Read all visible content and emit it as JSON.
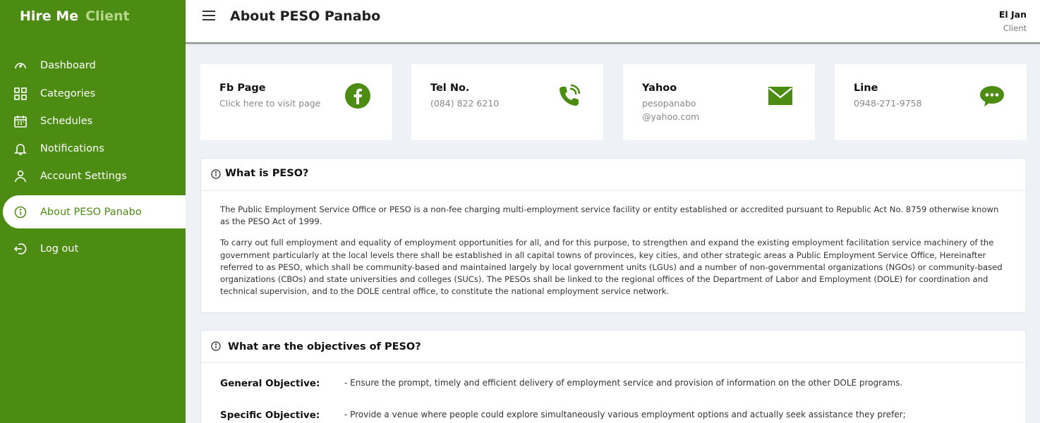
{
  "sidebar": {
    "brand_primary": "Hire Me",
    "brand_secondary": "Client",
    "items": [
      {
        "label": "Dashboard",
        "icon": "gauge-icon"
      },
      {
        "label": "Categories",
        "icon": "grid-icon"
      },
      {
        "label": "Schedules",
        "icon": "calendar-icon"
      },
      {
        "label": "Notifications",
        "icon": "bell-icon"
      },
      {
        "label": "Account Settings",
        "icon": "user-icon"
      },
      {
        "label": "About PESO Panabo",
        "icon": "info-icon",
        "active": true
      },
      {
        "label": "Log out",
        "icon": "logout-icon"
      }
    ]
  },
  "header": {
    "title": "About PESO Panabo",
    "user_name": "El Jan",
    "user_role": "Client"
  },
  "contacts": [
    {
      "title": "Fb Page",
      "value": "Click here to visit page",
      "icon": "facebook-icon"
    },
    {
      "title": "Tel No.",
      "value": "(084) 822 6210",
      "icon": "phone-icon"
    },
    {
      "title": "Yahoo",
      "value_line1": "pesopanabo",
      "value_line2": "@yahoo.com",
      "icon": "mail-icon"
    },
    {
      "title": "Line",
      "value": "0948-271-9758",
      "icon": "chat-icon"
    }
  ],
  "what_is": {
    "title": "What is PESO?",
    "paragraph1": "The Public Employment Service Office or PESO is a non-fee charging multi-employment service facility or entity established or accredited pursuant to Republic Act No. 8759 otherwise known as the PESO Act of 1999.",
    "paragraph2": "To carry out full employment and equality of employment opportunities for all, and for this purpose, to strengthen and expand the existing employment facilitation service machinery of the government particularly at the local levels there shall be established in all capital towns of provinces, key cities, and other strategic areas a Public Employment Service Office, Hereinafter referred to as PESO, which shall be community-based and maintained largely by local government units (LGUs) and a number of non-governmental organizations (NGOs) or community-based organizations (CBOs) and state universities and colleges (SUCs). The PESOs shall be linked to the regional offices of the Department of Labor and Employment (DOLE) for coordination and technical supervision, and to the DOLE central office, to constitute the national employment service network."
  },
  "objectives": {
    "title": "What are the objectives of PESO?",
    "general_label": "General Objective:",
    "general_text": "- Ensure the prompt, timely and efficient delivery of employment service and provision of information on the other DOLE programs.",
    "specific_label": "Specific Objective:",
    "specific_text": "- Provide a venue where people could explore simultaneously various employment options and actually seek assistance they prefer;"
  },
  "colors": {
    "brand_green": "#4c8c12",
    "brand_light": "#b6d88a",
    "background": "#eef1f6"
  }
}
